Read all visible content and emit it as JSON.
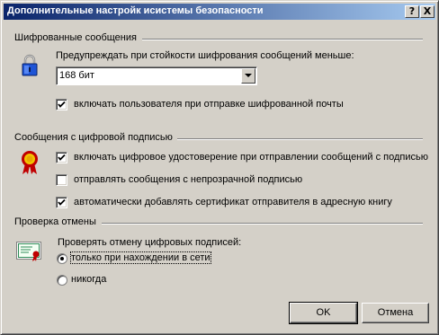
{
  "window": {
    "title": "Дополнительные настройк исистемы безопасности",
    "help_label": "?",
    "close_label": "X"
  },
  "encrypted": {
    "heading": "Шифрованные сообщения",
    "warn_label": "Предупреждать при стойкости шифрования сообщений меньше:",
    "strength_value": "168 бит",
    "include_self_label": "включать пользователя при отправке шифрованной почты",
    "include_self_checked": true
  },
  "signed": {
    "heading": "Сообщения с цифровой подписью",
    "include_cert_label": "включать цифровое удостоверение при отправлении сообщений с подписью",
    "include_cert_checked": true,
    "opaque_label": "отправлять сообщения с непрозрачной подписью",
    "opaque_checked": false,
    "add_cert_label": "автоматически добавлять сертификат отправителя в адресную книгу",
    "add_cert_checked": true
  },
  "revocation": {
    "heading": "Проверка отмены",
    "check_label": "Проверять отмену цифровых подписей:",
    "online_label": "только при нахождении в сети",
    "online_selected": true,
    "never_label": "никогда",
    "never_selected": false
  },
  "buttons": {
    "ok_label": "OK",
    "cancel_label": "Отмена"
  },
  "icons": {
    "lock": "padlock-icon",
    "signature": "rosette-icon",
    "revocation": "certificate-icon"
  }
}
